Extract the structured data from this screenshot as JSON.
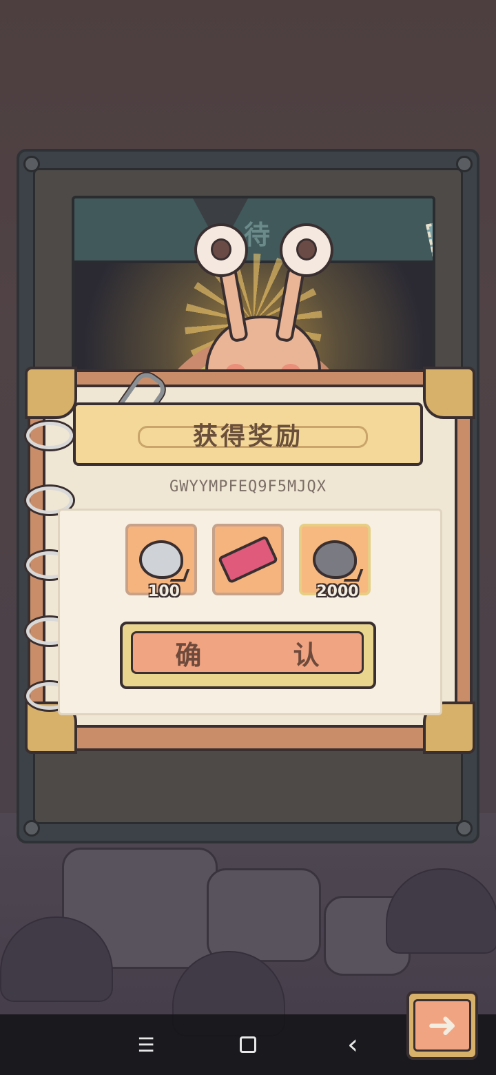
{
  "dialog": {
    "title": "获得奖励",
    "code": "GWYYMPFEQ9F5MJQX",
    "confirm_label": "确 认"
  },
  "scene": {
    "header_glyph": "待"
  },
  "rewards": [
    {
      "icon": "gray-blob-icon",
      "count": "100"
    },
    {
      "icon": "ticket-icon",
      "count": ""
    },
    {
      "icon": "dark-blob-icon",
      "count": "2000"
    }
  ],
  "next_button": {
    "icon": "arrow-right-icon",
    "glyph": "➜"
  },
  "nav": {
    "recents": "☰",
    "back": "‹"
  },
  "colors": {
    "panel": "#f0e6d4",
    "reward_bg": "#f5b37e",
    "confirm": "#f1a481",
    "title_banner": "#f3d89a"
  }
}
